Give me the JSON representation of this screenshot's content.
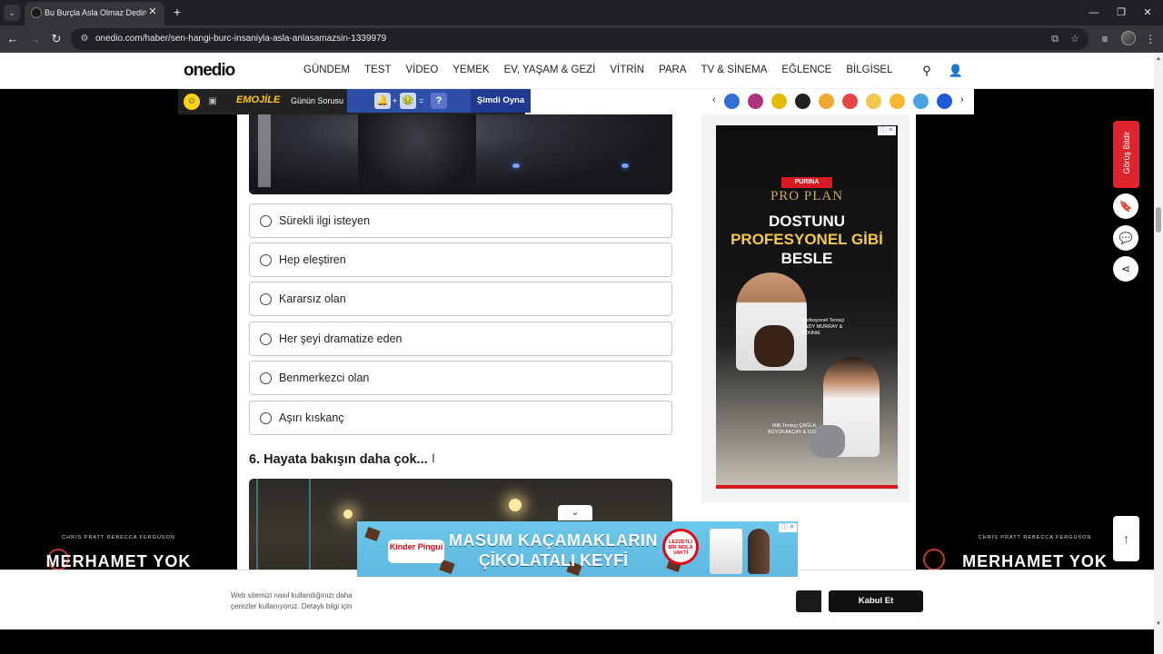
{
  "browser": {
    "tab_title": "Bu Burçla Asla Olmaz Dedirten",
    "url": "onedio.com/haber/sen-hangi-burc-insaniyla-asla-anlasamazsin-1339979"
  },
  "header": {
    "logo": "onedio",
    "nav": [
      "GÜNDEM",
      "TEST",
      "VİDEO",
      "YEMEK",
      "EV, YAŞAM & GEZİ",
      "VİTRİN",
      "PARA",
      "TV & SİNEMA",
      "EĞLENCE",
      "BİLGİSEL"
    ]
  },
  "strip": {
    "emojile": "EMOJİLE",
    "gunun_sorusu": "Günün Sorusu",
    "puzzle_eq": "=",
    "puzzle_plus": "+",
    "puzzle_q": "?",
    "play_button": "Şimdi Oyna"
  },
  "quiz": {
    "options": [
      "Sürekli ilgi isteyen",
      "Hep eleştiren",
      "Kararsız olan",
      "Her şeyi dramatize eden",
      "Benmerkezci olan",
      "Aşırı kıskanç"
    ],
    "next_question": "6. Hayata bakışın daha çok..."
  },
  "sidebar_ad": {
    "brand": "PURINA",
    "product": "PRO PLAN",
    "line1": "DOSTUNU",
    "line2": "PROFESYONEL GİBİ",
    "line3": "BESLE",
    "caption1": "Profesyonel Tenisçi ANDY MURRAY & BONNIE",
    "caption2": "Milli Tenisçi ÇAĞLA BÜYÜKAKÇAY & İZO"
  },
  "skin_ad": {
    "credit": "CHRIS PRATT  REBECCA FERGUSON",
    "title": "MERHAMET YOK"
  },
  "feedback": {
    "label": "Görüş Bildir"
  },
  "cookie": {
    "text_line1": "Web sitemizi nasıl kullandığınızı daha",
    "text_line2": "çerezler kullanıyoruz. Detaylı bilgi için",
    "accept": "Kabul Et"
  },
  "bottom_ad": {
    "brand": "Kinder Pingui",
    "line1": "MASUM KAÇAMAKLARIN",
    "line2": "ÇİKOLATALI KEYFİ",
    "clock": "LEZZETLİ BİR MOLA VAKTİ"
  }
}
